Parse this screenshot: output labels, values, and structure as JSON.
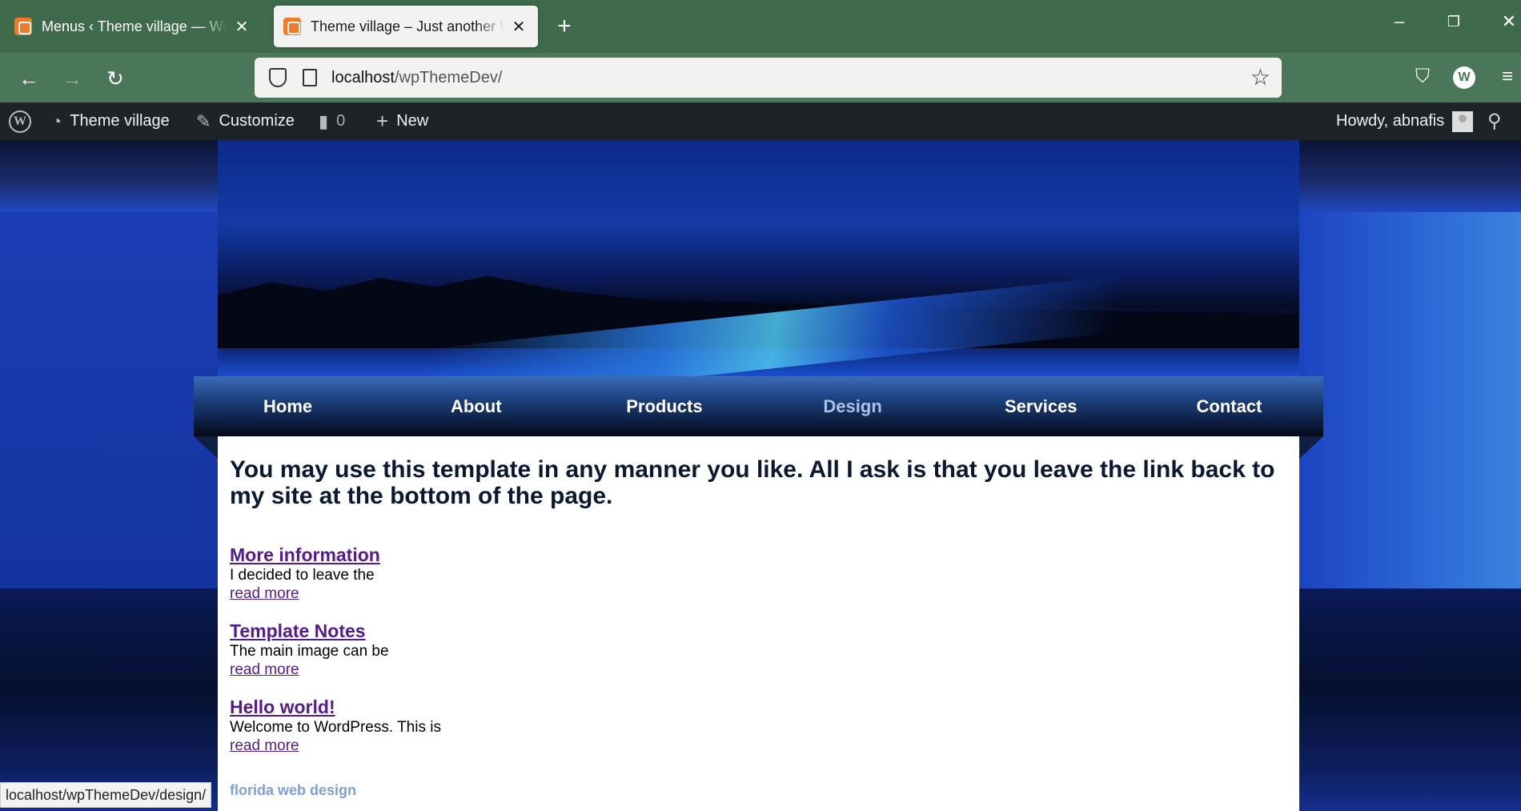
{
  "browser": {
    "tabs": [
      {
        "title": "Menus ‹ Theme village — WordPress",
        "active": false
      },
      {
        "title": "Theme village – Just another WordPress site",
        "active": true
      }
    ],
    "new_tab": "+",
    "url_host": "localhost",
    "url_path": "/wpThemeDev/",
    "status_url": "localhost/wpThemeDev/design/",
    "profile_initial": "W",
    "icons": [
      "back-icon",
      "forward-icon",
      "reload-icon",
      "shield-icon",
      "page-icon",
      "star-icon",
      "pocket-icon",
      "menu-icon",
      "minimize-icon",
      "restore-icon",
      "close-icon"
    ]
  },
  "adminbar": {
    "site_name": "Theme village",
    "customize": "Customize",
    "comments_count": "0",
    "new": "New",
    "howdy": "Howdy, abnafis"
  },
  "menu": {
    "items": [
      "Home",
      "About",
      "Products",
      "Design",
      "Services",
      "Contact"
    ],
    "current": "Design"
  },
  "content": {
    "heading": "You may use this template in any manner you like. All I ask is that you leave the link back to my site at the bottom of the page.",
    "posts": [
      {
        "title": "More information",
        "excerpt": "I decided to leave the",
        "more": "read more"
      },
      {
        "title": "Template Notes",
        "excerpt": "The main image can be",
        "more": "read more"
      },
      {
        "title": "Hello world!",
        "excerpt": "Welcome to WordPress. This is",
        "more": "read more"
      }
    ],
    "footer_link": "florida web design"
  },
  "colors": {
    "browser_tabbar": "#3f6b4c",
    "adminbar": "#1d2327",
    "link_visited": "#551a8b",
    "footer_link": "#7c9fd8",
    "menu_current": "#a9c3e8"
  }
}
